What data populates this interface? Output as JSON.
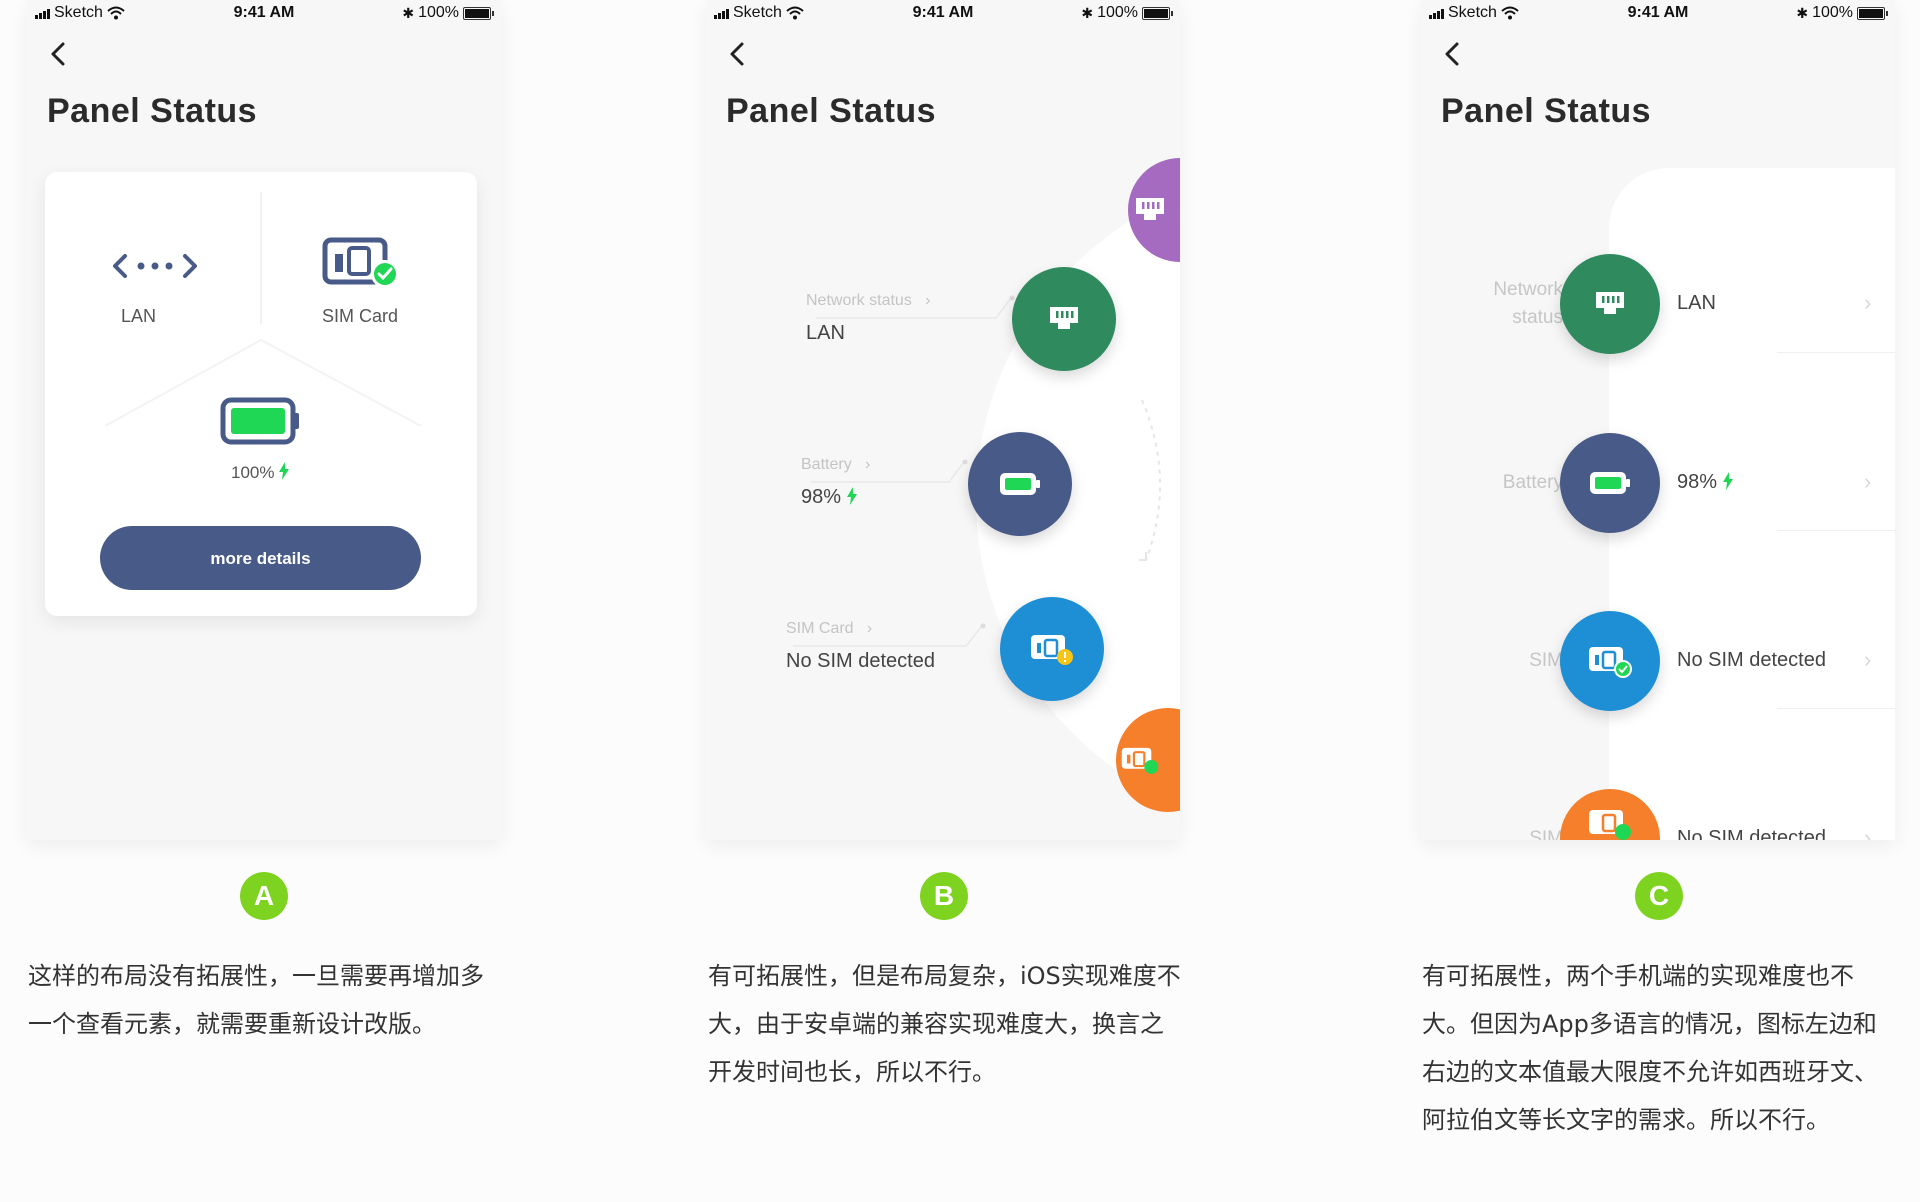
{
  "colors": {
    "green_circle": "#2f8a5e",
    "navy": "#485a87",
    "blue": "#1e8fd4",
    "orange": "#f57f2a",
    "purple": "#a56bc0",
    "battery_green": "#1fd655",
    "badge_green": "#7ed321"
  },
  "status_bar": {
    "carrier": "Sketch",
    "time": "9:41 AM",
    "battery": "100%"
  },
  "phone_a": {
    "title": "Panel Status",
    "lan_label": "LAN",
    "sim_label": "SIM Card",
    "battery_label": "100%",
    "button_label": "more details"
  },
  "phone_b": {
    "title": "Panel Status",
    "network_label": "Network status",
    "network_value": "LAN",
    "battery_label": "Battery",
    "battery_value": "98%",
    "sim_label": "SIM Card",
    "sim_value": "No SIM detected"
  },
  "phone_c": {
    "title": "Panel Status",
    "rows": [
      {
        "label": "Network status",
        "value": "LAN"
      },
      {
        "label": "Battery",
        "value": "98%"
      },
      {
        "label": "SIM",
        "value": "No SIM detected"
      },
      {
        "label": "SIM",
        "value": "No SIM detected"
      }
    ]
  },
  "badges": {
    "a": "A",
    "b": "B",
    "c": "C"
  },
  "captions": {
    "a": "这样的布局没有拓展性，一旦需要再增加多一个查看元素，就需要重新设计改版。",
    "b": "有可拓展性，但是布局复杂，iOS实现难度不大，由于安卓端的兼容实现难度大，换言之开发时间也长，所以不行。",
    "c": "有可拓展性，两个手机端的实现难度也不大。但因为App多语言的情况，图标左边和右边的文本值最大限度不允许如西班牙文、阿拉伯文等长文字的需求。所以不行。"
  }
}
